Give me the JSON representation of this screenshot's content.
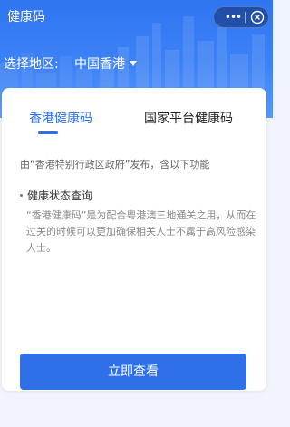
{
  "header": {
    "title": "健康码",
    "region_label": "选择地区:",
    "region_value": "中国香港"
  },
  "window_controls": {
    "more_glyph": "•••"
  },
  "tabs": [
    {
      "label": "香港健康码",
      "active": true
    },
    {
      "label": "国家平台健康码",
      "active": false
    }
  ],
  "content": {
    "intro": "由“香港特别行政区政府”发布，含以下功能",
    "feature_title": "健康状态查询",
    "feature_description": "“香港健康码”是为配合粤港澳三地通关之用，从而在过关的时候可以更加确保相关人士不属于高风险感染人士。"
  },
  "actions": {
    "primary_button": "立即查看"
  },
  "colors": {
    "accent": "#2f6fe8",
    "header_bg": "#3d82f6",
    "page_bg": "#f1f5fb"
  },
  "icons": {
    "more": "more-icon",
    "close": "close-circle-icon",
    "dropdown": "caret-down-icon"
  }
}
